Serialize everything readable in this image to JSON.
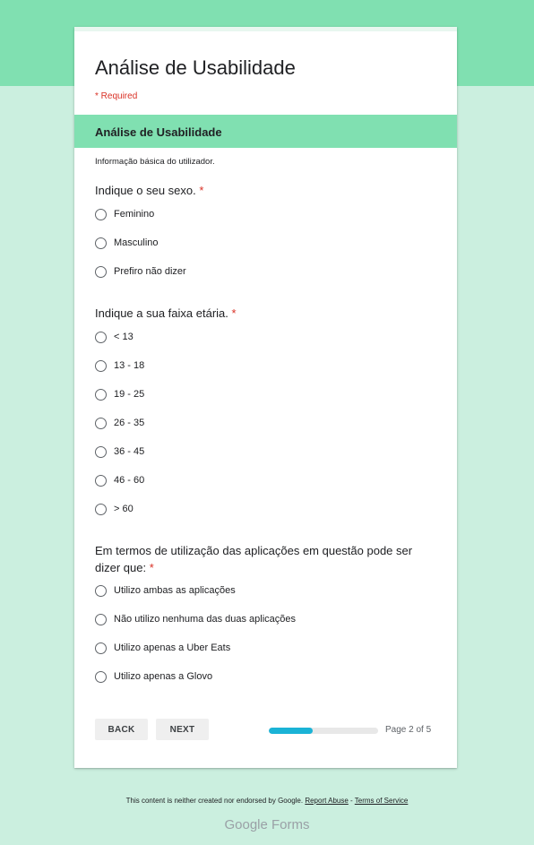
{
  "form": {
    "title": "Análise de Usabilidade",
    "required_note": "* Required"
  },
  "section": {
    "title": "Análise de Usabilidade",
    "description": "Informação básica do utilizador."
  },
  "questions": [
    {
      "text": "Indique o seu sexo.",
      "required_mark": "*",
      "options": [
        "Feminino",
        "Masculino",
        "Prefiro não dizer"
      ]
    },
    {
      "text": "Indique a sua faixa etária.",
      "required_mark": "*",
      "options": [
        "< 13",
        "13 - 18",
        "19 - 25",
        "26 - 35",
        "36 - 45",
        "46 - 60",
        "> 60"
      ]
    },
    {
      "text": "Em termos de utilização das aplicações em questão pode ser dizer que:",
      "required_mark": "*",
      "options": [
        "Utilizo ambas as aplicações",
        "Não utilizo nenhuma das duas aplicações",
        "Utilizo apenas a Uber Eats",
        "Utilizo apenas a Glovo"
      ]
    }
  ],
  "navigation": {
    "back_label": "BACK",
    "next_label": "NEXT",
    "progress_fraction": 0.4,
    "progress_text": "Page 2 of 5"
  },
  "footer": {
    "disclaimer": "This content is neither created nor endorsed by Google.",
    "report_abuse": "Report Abuse",
    "separator": " - ",
    "terms": "Terms of Service",
    "logo_google": "Google",
    "logo_forms": "Forms"
  },
  "colors": {
    "accent": "#80e0b1",
    "background": "#cbefdf",
    "required": "#d93025",
    "progress": "#1ab3d6"
  }
}
